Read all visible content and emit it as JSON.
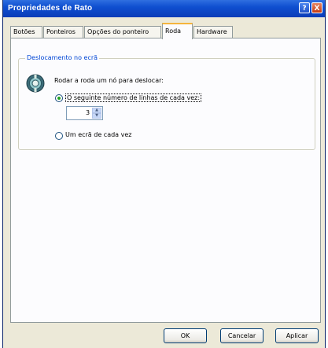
{
  "window": {
    "title": "Propriedades de Rato",
    "help_glyph": "?",
    "close_glyph": "X"
  },
  "tabs": [
    {
      "label": "Botões",
      "active": false
    },
    {
      "label": "Ponteiros",
      "active": false
    },
    {
      "label": "Opções do ponteiro",
      "active": false
    },
    {
      "label": "Roda",
      "active": true
    },
    {
      "label": "Hardware",
      "active": false
    }
  ],
  "group": {
    "legend": "Deslocamento no ecrã",
    "instruction": "Rodar a roda um nó para deslocar:",
    "option_lines": "O seguinte número de linhas de cada vez:",
    "lines_value": "3",
    "option_screen": "Um ecrã de cada vez",
    "selected_option": "lines"
  },
  "buttons": {
    "ok": "OK",
    "cancel": "Cancelar",
    "apply": "Aplicar"
  },
  "colors": {
    "title_bar": "#0a3cb8",
    "active_tab_accent": "#f5b43c",
    "group_legend": "#0046d5",
    "dialog_face": "#ece9d8"
  }
}
